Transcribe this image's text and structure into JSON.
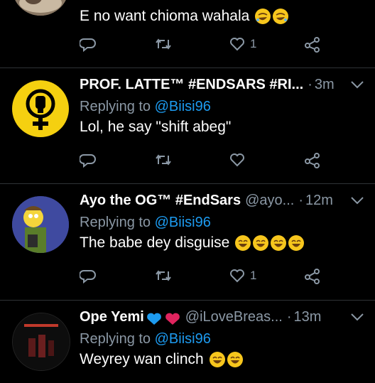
{
  "tweets": [
    {
      "name": "",
      "handle": "",
      "time": "",
      "replying_prefix": "",
      "replying_to": "",
      "text": "E no want chioma wahala",
      "emoji": [
        "rofl-emoji",
        "rofl-emoji"
      ],
      "likes": "1"
    },
    {
      "name": "PROF. LATTE™ #ENDSARS #RI...",
      "handle": "",
      "time": "3m",
      "replying_prefix": "Replying to",
      "replying_to": "@Biisi96",
      "text": "Lol, he say \"shift abeg\"",
      "emoji": [],
      "likes": ""
    },
    {
      "name": "Ayo the OG™ #EndSars",
      "handle": "@ayo...",
      "time": "12m",
      "replying_prefix": "Replying to",
      "replying_to": "@Biisi96",
      "text": "The babe dey disguise",
      "emoji": [
        "laughing-emoji",
        "laughing-emoji",
        "laughing-emoji",
        "laughing-emoji"
      ],
      "likes": "1"
    },
    {
      "name": "Ope Yemi",
      "handle": "@iLoveBreas...",
      "time": "13m",
      "replying_prefix": "Replying to",
      "replying_to": "@Biisi96",
      "text": "Weyrey wan clinch",
      "emoji": [
        "laughing-emoji",
        "laughing-emoji"
      ],
      "likes": ""
    }
  ],
  "colors": {
    "background": "#000000",
    "secondary_text": "#8b98a5",
    "mention": "#1d9bf0",
    "avatar_yellow": "#f5d010"
  }
}
